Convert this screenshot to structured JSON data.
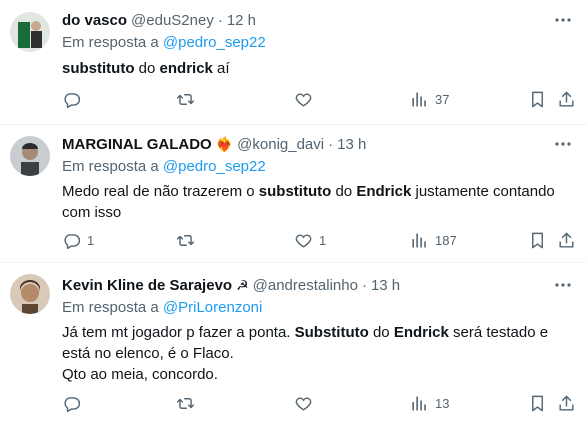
{
  "reply_prefix": "Em resposta a",
  "tweets": [
    {
      "name": "do vasco",
      "emoji": "",
      "handle": "@eduS2ney",
      "dot": "·",
      "time": "12 h",
      "reply_to": "@pedro_sep22",
      "body": [
        {
          "bold": "substituto",
          "text": " do "
        },
        {
          "bold": "endrick",
          "text": " aí"
        }
      ],
      "counts": {
        "reply": "",
        "retweet": "",
        "like": "",
        "views": "37"
      }
    },
    {
      "name": "MARGINAL GALADO",
      "emoji": "❤️‍🔥",
      "handle": "@konig_davi",
      "dot": "·",
      "time": "13 h",
      "reply_to": "@pedro_sep22",
      "body_text": "Medo real de não trazerem o ",
      "body_bold_1": "substituto",
      "body_text_2": " do ",
      "body_bold_2": "Endrick",
      "body_text_3": " justamente contando com isso",
      "counts": {
        "reply": "1",
        "retweet": "",
        "like": "1",
        "views": "187"
      }
    },
    {
      "name": "Kevin Kline de Sarajevo",
      "emoji": "☭",
      "handle": "@andrestalinho",
      "dot": "·",
      "time": "13 h",
      "reply_to": "@PriLorenzoni",
      "body_text": "Já tem mt jogador p fazer a ponta. ",
      "body_bold_1": "Substituto",
      "body_text_2": " do ",
      "body_bold_2": "Endrick",
      "body_text_3": " será testado e está no elenco, é o Flaco.",
      "body_line_2": "Qto ao meia, concordo.",
      "counts": {
        "reply": "",
        "retweet": "",
        "like": "",
        "views": "13"
      }
    }
  ],
  "colors": {
    "text": "#0f1419",
    "secondary": "#536471",
    "link": "#1d9bf0",
    "divider": "#eff3f4",
    "heart_emoji": "#e0245e"
  },
  "icons": [
    "more-icon",
    "reply-icon",
    "retweet-icon",
    "like-icon",
    "views-icon",
    "bookmark-icon",
    "share-icon"
  ]
}
